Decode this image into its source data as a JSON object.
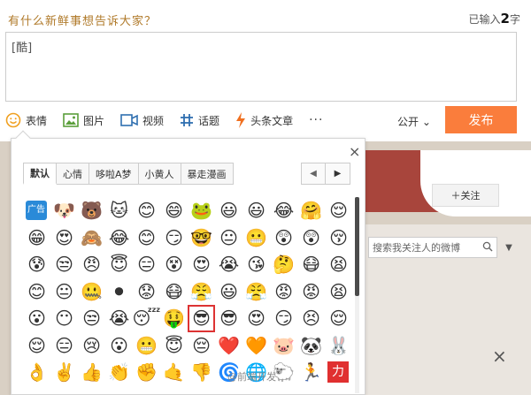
{
  "composer": {
    "prompt": "有什么新鲜事想告诉大家？",
    "count_prefix": "已输入",
    "count_value": "2",
    "count_suffix": "字",
    "text": "[酷]",
    "toolbar": [
      {
        "label": "表情",
        "icon": "smiley-icon",
        "color": "#f0a020"
      },
      {
        "label": "图片",
        "icon": "image-icon",
        "color": "#5a9e3a"
      },
      {
        "label": "视频",
        "icon": "video-icon",
        "color": "#2f6fb0"
      },
      {
        "label": "话题",
        "icon": "hashtag-icon",
        "color": "#2f6fb0"
      },
      {
        "label": "头条文章",
        "icon": "lightning-icon",
        "color": "#f07020"
      }
    ],
    "more": "···",
    "visibility": "公开",
    "publish": "发布"
  },
  "emoji_panel": {
    "tabs": [
      "默认",
      "心情",
      "哆啦A梦",
      "小黄人",
      "暴走漫画"
    ],
    "prev": "◀",
    "next": "▶",
    "close": "×",
    "selected_index": 54,
    "emojis": [
      "广告",
      "🐶",
      "🐻",
      "🐱",
      "😊",
      "😄",
      "🐸",
      "😃",
      "😃",
      "😂",
      "🤗",
      "😌",
      "😁",
      "😍",
      "🙈",
      "😂",
      "😊",
      "😏",
      "🤓",
      "😐",
      "😬",
      "😲",
      "😲",
      "😚",
      "😰",
      "😒",
      "😠",
      "😇",
      "😑",
      "😵",
      "😍",
      "😭",
      "😘",
      "🤔",
      "😷",
      "😫",
      "😊",
      "😐",
      "🤐",
      "⚫",
      "😟",
      "😷",
      "😤",
      "😃",
      "😤",
      "😡",
      "😡",
      "😫",
      "😮",
      "😶",
      "😒",
      "😭",
      "😴",
      "🤑",
      "😎",
      "😎",
      "😍",
      "😏",
      "😣",
      "😌",
      "😌",
      "😑",
      "😢",
      "😮",
      "😬",
      "😇",
      "😔",
      "❤️",
      "🧡",
      "🐷",
      "🐼",
      "🐰",
      "👌",
      "✌️",
      "👍",
      "👏",
      "✊",
      "🤙",
      "👎",
      "🌀",
      "🌐",
      "🐑",
      "🏃",
      "力"
    ]
  },
  "background": {
    "follow_button": "＋关注",
    "search_placeholder": "搜索我关注人的微博",
    "close": "×",
    "watermark": "@前端开发"
  }
}
